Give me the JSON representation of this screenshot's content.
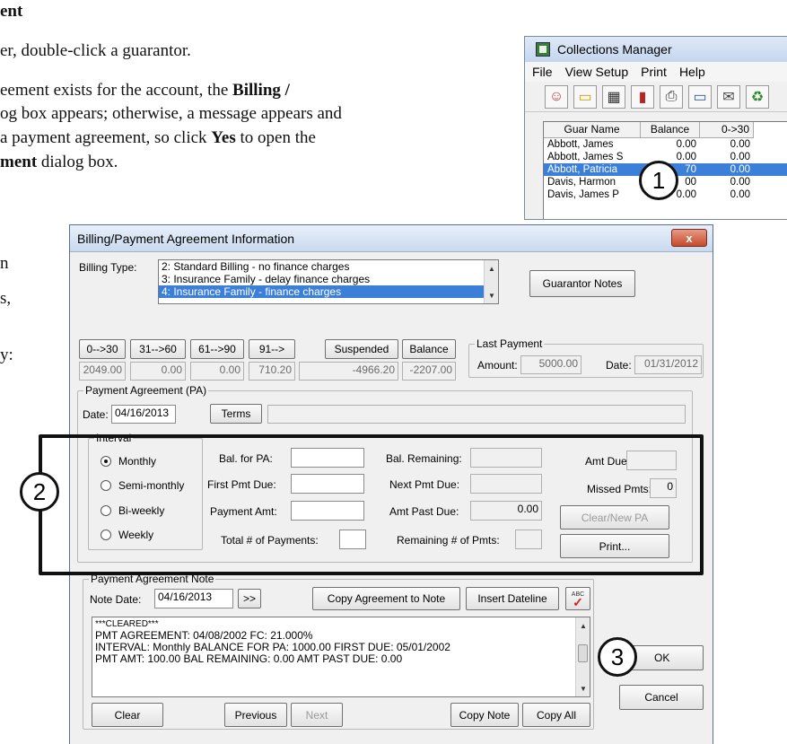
{
  "doc": {
    "line1": "ent",
    "line2": "er, double-click a guarantor.",
    "line3a": "eement exists for the account, the ",
    "line3b": "Billing /",
    "line4": "og box appears; otherwise, a message appears and",
    "line5a": "a payment agreement, so click ",
    "line5b": "Yes",
    "line5c": " to open the",
    "line6a": "ment",
    "line6b": " dialog box.",
    "line7": "n",
    "line8": "s,",
    "line9": "y:"
  },
  "collections_manager": {
    "title": "Collections Manager",
    "menu": [
      "File",
      "View Setup",
      "Print",
      "Help"
    ],
    "toolbar_icons": [
      "guarantor-icon",
      "folder-icon",
      "calculator-icon",
      "book-icon",
      "printer-icon",
      "card-icon",
      "envelope-icon",
      "recycle-icon"
    ],
    "toolbar_glyphs": [
      "☺",
      "▭",
      "▦",
      "▮",
      "⎙",
      "▭",
      "✉",
      "♻"
    ],
    "columns": [
      "Guar Name",
      "Balance",
      "0->30"
    ],
    "rows": [
      {
        "name": "Abbott, James",
        "balance": "0.00",
        "c030": "0.00"
      },
      {
        "name": "Abbott, James S",
        "balance": "0.00",
        "c030": "0.00"
      },
      {
        "name": "Abbott, Patricia",
        "balance": "70",
        "c030": "0.00"
      },
      {
        "name": "Davis, Harmon",
        "balance": "00",
        "c030": "0.00"
      },
      {
        "name": "Davis, James P",
        "balance": "0.00",
        "c030": "0.00"
      }
    ]
  },
  "dialog": {
    "title": "Billing/Payment Agreement Information",
    "close_label": "x",
    "billing_type_label": "Billing Type:",
    "billing_types": [
      "2: Standard Billing - no finance charges",
      "3: Insurance Family - delay finance charges",
      "4: Insurance Family - finance charges"
    ],
    "guarantor_notes_label": "Guarantor Notes",
    "aging": {
      "headers": [
        "0-->30",
        "31-->60",
        "61-->90",
        "91-->",
        "Suspended",
        "Balance"
      ],
      "values": [
        "2049.00",
        "0.00",
        "0.00",
        "710.20",
        "-4966.20",
        "-2207.00"
      ]
    },
    "last_payment": {
      "legend": "Last Payment",
      "amount_label": "Amount:",
      "amount": "5000.00",
      "date_label": "Date:",
      "date": "01/31/2012"
    },
    "pa": {
      "legend": "Payment Agreement (PA)",
      "date_label": "Date:",
      "date": "04/16/2013",
      "terms_label": "Terms",
      "interval_legend": "Interval",
      "intervals": [
        "Monthly",
        "Semi-monthly",
        "Bi-weekly",
        "Weekly"
      ],
      "selected_interval": "Monthly",
      "bal_for_pa_label": "Bal. for PA:",
      "first_pmt_due_label": "First Pmt Due:",
      "payment_amt_label": "Payment Amt:",
      "total_payments_label": "Total # of Payments:",
      "bal_remaining_label": "Bal. Remaining:",
      "next_pmt_due_label": "Next Pmt Due:",
      "amt_past_due_label": "Amt Past Due:",
      "amt_past_due": "0.00",
      "remaining_pmts_label": "Remaining # of Pmts:",
      "amt_due_label": "Amt Due:",
      "missed_pmts_label": "Missed Pmts:",
      "missed_pmts": "0",
      "clear_new_pa_label": "Clear/New PA",
      "print_label": "Print..."
    },
    "note": {
      "legend": "Payment Agreement Note",
      "note_date_label": "Note Date:",
      "note_date": "04/16/2013",
      "next_date_label": ">>",
      "copy_agreement_label": "Copy Agreement to Note",
      "insert_dateline_label": "Insert Dateline",
      "spell_label": "ABC",
      "lines": [
        "***CLEARED***",
        "PMT AGREEMENT: 04/08/2002  FC: 21.000%",
        "INTERVAL: Monthly  BALANCE FOR PA: 1000.00  FIRST DUE: 05/01/2002",
        "PMT AMT: 100.00  BAL REMAINING: 0.00  AMT PAST DUE: 0.00"
      ],
      "clear_label": "Clear",
      "previous_label": "Previous",
      "next_label": "Next",
      "copy_note_label": "Copy Note",
      "copy_all_label": "Copy All"
    },
    "ok_label": "OK",
    "cancel_label": "Cancel"
  },
  "callouts": [
    "1",
    "2",
    "3"
  ]
}
